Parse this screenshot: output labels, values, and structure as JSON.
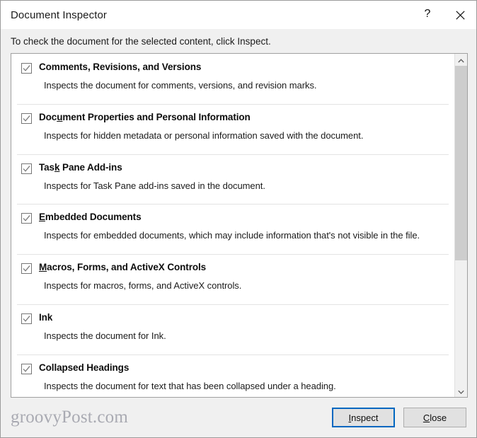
{
  "window": {
    "title": "Document Inspector",
    "help_icon": "question-mark-icon",
    "close_icon": "close-icon",
    "help_label": "?"
  },
  "instruction": {
    "text": "To check the document for the selected content, click Inspect."
  },
  "list": {
    "items": [
      {
        "title_pre": "Comments, Revisions, and Versions",
        "accel": "",
        "title_post": "",
        "title_full": "Comments, Revisions, and Versions",
        "description": "Inspects the document for comments, versions, and revision marks.",
        "checked": true
      },
      {
        "title_pre": "Doc",
        "accel": "u",
        "title_post": "ment Properties and Personal Information",
        "title_full": "Document Properties and Personal Information",
        "description": "Inspects for hidden metadata or personal information saved with the document.",
        "checked": true
      },
      {
        "title_pre": "Tas",
        "accel": "k",
        "title_post": " Pane Add-ins",
        "title_full": "Task Pane Add-ins",
        "description": "Inspects for Task Pane add-ins saved in the document.",
        "checked": true
      },
      {
        "title_pre": "",
        "accel": "E",
        "title_post": "mbedded Documents",
        "title_full": "Embedded Documents",
        "description": "Inspects for embedded documents, which may include information that's not visible in the file.",
        "checked": true
      },
      {
        "title_pre": "",
        "accel": "M",
        "title_post": "acros, Forms, and ActiveX Controls",
        "title_full": "Macros, Forms, and ActiveX Controls",
        "description": "Inspects for macros, forms, and ActiveX controls.",
        "checked": true
      },
      {
        "title_pre": "Ink",
        "accel": "",
        "title_post": "",
        "title_full": "Ink",
        "description": "Inspects the document for Ink.",
        "checked": true
      },
      {
        "title_pre": "Collapsed Headings",
        "accel": "",
        "title_post": "",
        "title_full": "Collapsed Headings",
        "description": "Inspects the document for text that has been collapsed under a heading.",
        "checked": true
      }
    ]
  },
  "scrollbar": {
    "up_icon": "chevron-up-icon",
    "down_icon": "chevron-down-icon",
    "thumb_fraction_percent": 61
  },
  "footer": {
    "watermark": "groovyPost.com",
    "inspect": {
      "pre": "",
      "accel": "I",
      "post": "nspect",
      "full": "Inspect"
    },
    "close": {
      "pre": "",
      "accel": "C",
      "post": "lose",
      "full": "Close"
    }
  },
  "colors": {
    "accent": "#0067c0",
    "dialog_bg": "#f0f0f0",
    "list_bg": "#ffffff",
    "text": "#1b1b1b",
    "watermark": "#a9aab2"
  }
}
